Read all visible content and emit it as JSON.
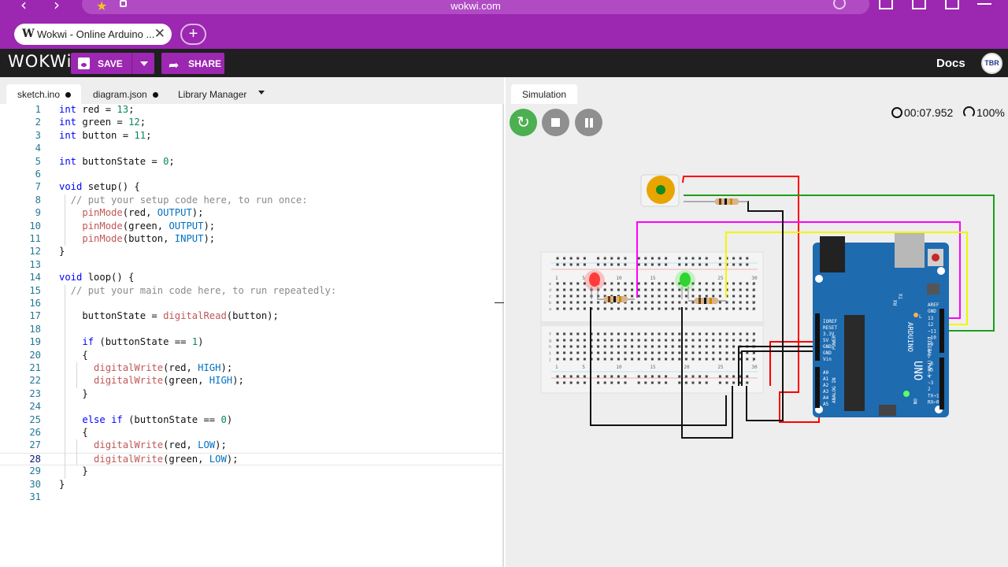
{
  "browser": {
    "url": "wokwi.com",
    "tab_title": "Wokwi - Online Arduino ...",
    "tab_logo": "W",
    "close_glyph": "✕",
    "new_tab_glyph": "+",
    "back_glyph": "‹",
    "forward_glyph": "›",
    "star_glyph": "★"
  },
  "header": {
    "logo": "WOKWi",
    "save_label": "SAVE",
    "share_label": "SHARE",
    "share_glyph": "➦",
    "docs_label": "Docs",
    "avatar_text": "TBR"
  },
  "editor": {
    "tabs": [
      {
        "label": "sketch.ino",
        "modified": true
      },
      {
        "label": "diagram.json",
        "modified": true
      },
      {
        "label": "Library Manager",
        "modified": false
      }
    ],
    "current_line": 28,
    "lines": [
      "int red = 13;",
      "int green = 12;",
      "int button = 11;",
      "",
      "int buttonState = 0;",
      "",
      "void setup() {",
      "  // put your setup code here, to run once:",
      "    pinMode(red, OUTPUT);",
      "    pinMode(green, OUTPUT);",
      "    pinMode(button, INPUT);",
      "}",
      "",
      "void loop() {",
      "  // put your main code here, to run repeatedly:",
      "",
      "    buttonState = digitalRead(button);",
      "",
      "    if (buttonState == 1)",
      "    {",
      "      digitalWrite(red, HIGH);",
      "      digitalWrite(green, HIGH);",
      "    }",
      "",
      "    else if (buttonState == 0)",
      "    {",
      "      digitalWrite(red, LOW);",
      "      digitalWrite(green, LOW);",
      "    }",
      "}",
      ""
    ]
  },
  "simulation": {
    "tab_label": "Simulation",
    "restart_glyph": "↻",
    "timer": "00:07.952",
    "speed": "100%",
    "board": {
      "brand": "ARDUINO",
      "model": "UNO",
      "aref": "AREF",
      "gnd": "GND",
      "power_labels": [
        "IOREF",
        "RESET",
        "3.3V",
        "5V",
        "GND",
        "GND",
        "Vin"
      ],
      "analog_labels": [
        "A0",
        "A1",
        "A2",
        "A3",
        "A4",
        "A5"
      ],
      "digital_labels": [
        "13",
        "12",
        "~11",
        "~10",
        "~9",
        "8",
        "7",
        "~6",
        "~5",
        "4",
        "~3",
        "2",
        "TX→1",
        "RX←0"
      ],
      "power_text": "POWER",
      "analog_text": "ANALOG IN",
      "digital_text": "DIGITAL (PWM~)",
      "on_text": "ON",
      "tx": "TX",
      "rx": "RX",
      "l_text": "L"
    },
    "breadboard": {
      "col_numbers": [
        "1",
        "5",
        "10",
        "15",
        "20",
        "25",
        "30"
      ],
      "row_letters_top": [
        "a",
        "b",
        "c",
        "d",
        "e"
      ],
      "row_letters_bottom": [
        "f",
        "g",
        "h",
        "i",
        "j"
      ]
    },
    "colors": {
      "led_red": "#ff2a2a",
      "led_green": "#2ee82e",
      "wire_red": "#ff0000",
      "wire_green": "#1aa01a",
      "wire_magenta": "#ff00ff",
      "wire_yellow": "#f5f500",
      "wire_black": "#111111",
      "button_cap": "#e8a500",
      "board_blue": "#1e6bb0"
    }
  }
}
